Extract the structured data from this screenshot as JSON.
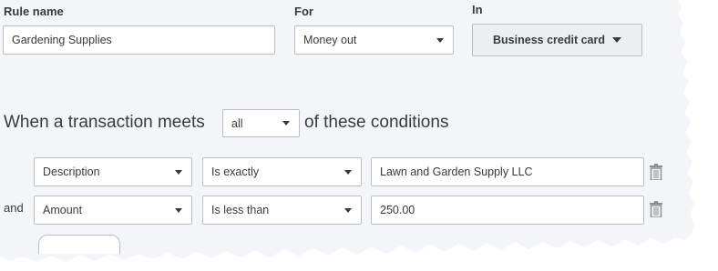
{
  "rule": {
    "name_label": "Rule name",
    "name_value": "Gardening Supplies",
    "for_label": "For",
    "for_value": "Money out",
    "in_label": "In",
    "in_value": "Business credit card"
  },
  "condition_sentence": {
    "prefix": "When a transaction meets",
    "match_value": "all",
    "suffix": "of these conditions"
  },
  "conditions": [
    {
      "connector": "",
      "field": "Description",
      "operator": "Is exactly",
      "value": "Lawn and Garden Supply LLC"
    },
    {
      "connector": "and",
      "field": "Amount",
      "operator": "Is less than",
      "value": "250.00"
    }
  ],
  "icons": {
    "dropdown": "chevron-down-icon",
    "delete": "trash-icon"
  }
}
